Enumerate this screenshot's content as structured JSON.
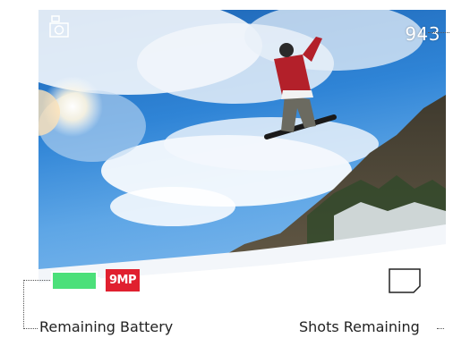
{
  "screen": {
    "shots_remaining_value": "943",
    "resolution_badge": "9MP"
  },
  "icons": {
    "mode": "camera-photo-icon",
    "battery": "battery-full-icon",
    "storage": "sd-card-icon"
  },
  "colors": {
    "battery_fill": "#4be07a",
    "badge_bg": "#e0202f"
  },
  "callouts": {
    "battery_label": "Remaining Battery",
    "shots_label": "Shots Remaining"
  }
}
